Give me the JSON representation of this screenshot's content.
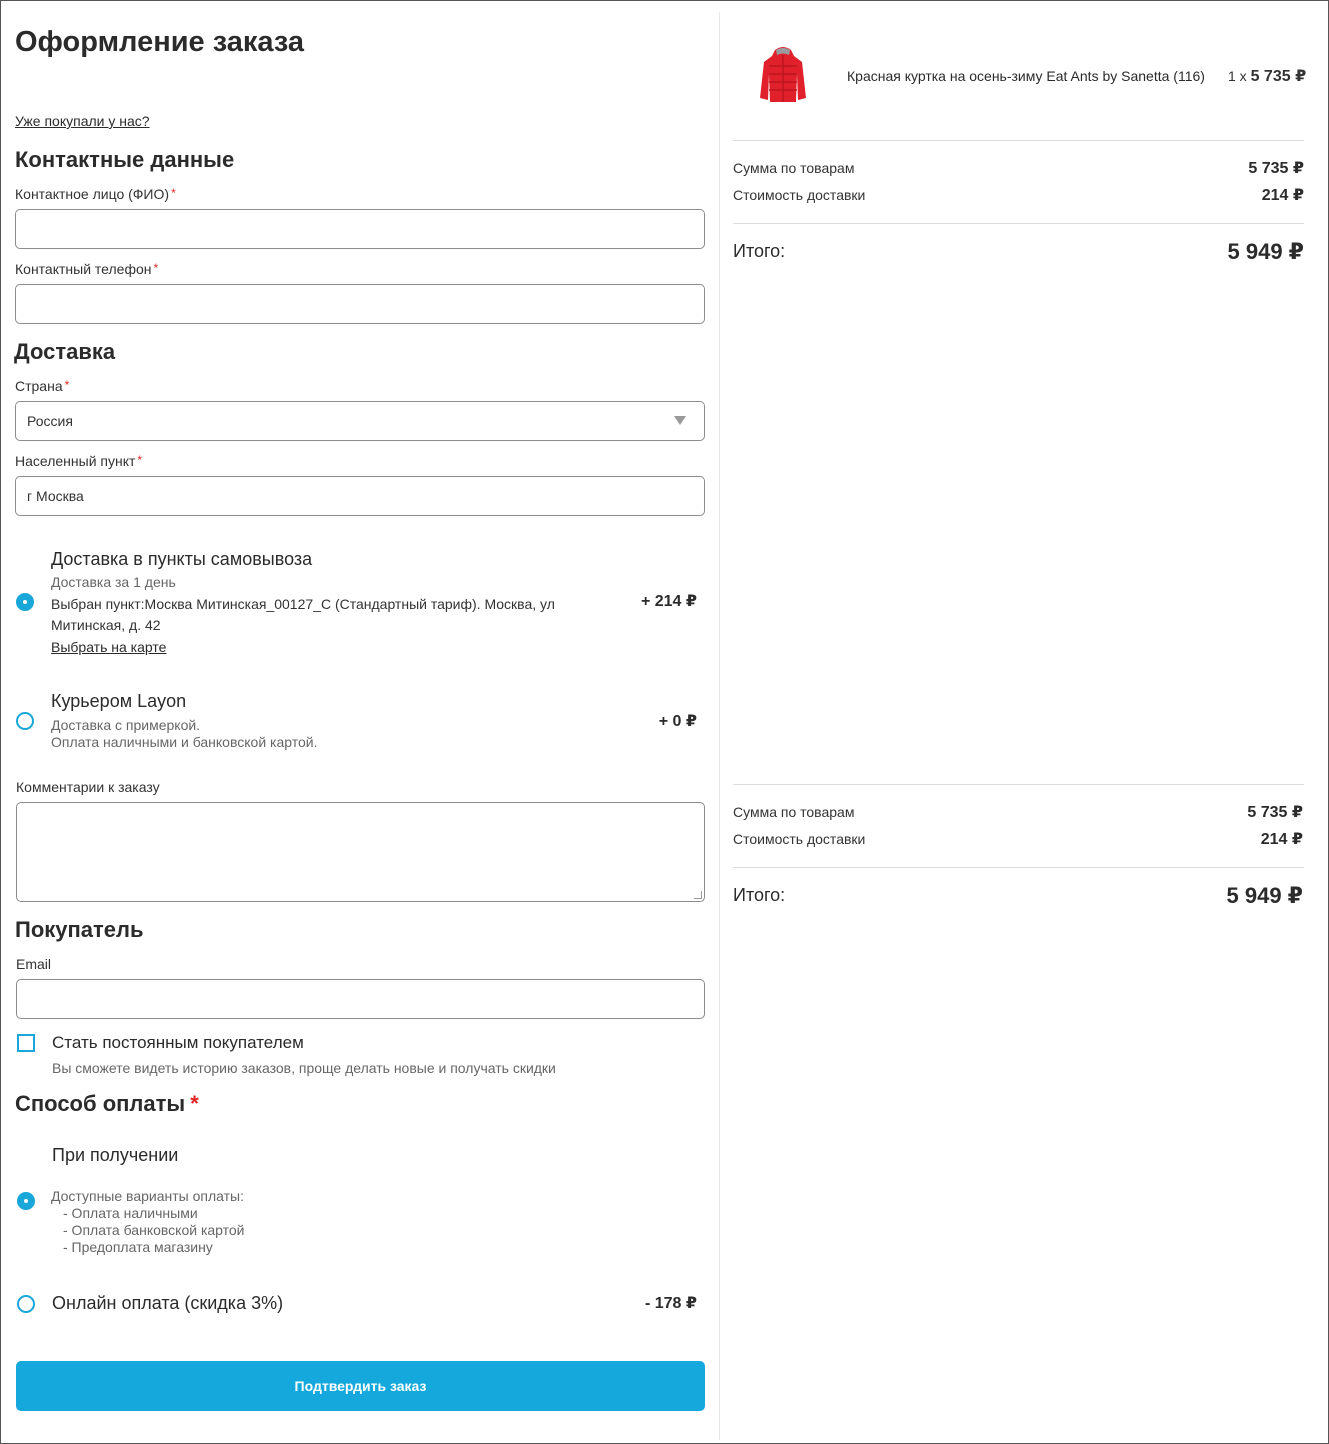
{
  "page": {
    "title": "Оформление заказа",
    "returning_link": "Уже покупали у нас?"
  },
  "contacts": {
    "heading": "Контактные данные",
    "name_label": "Контактное лицо (ФИО)",
    "name_value": "",
    "phone_label": "Контактный телефон",
    "phone_value": ""
  },
  "delivery": {
    "heading": "Доставка",
    "country_label": "Страна",
    "country_value": "Россия",
    "city_label": "Населенный пункт",
    "city_value": "г Москва",
    "options": [
      {
        "title": "Доставка в пункты самовывоза",
        "subtitle": "Доставка за 1 день",
        "desc_line1": "Выбран пункт:Москва Митинская_00127_С (Стандартный тариф). Москва, ул",
        "desc_line2": "Митинская, д. 42",
        "map_link": "Выбрать на карте",
        "price": "+ 214 ₽",
        "selected": true
      },
      {
        "title": "Курьером Layon",
        "subtitle": "Доставка с примеркой.",
        "subtitle2": "Оплата наличными и банковской картой.",
        "price": "+ 0 ₽",
        "selected": false
      }
    ],
    "comment_label": "Комментарии к заказу",
    "comment_value": ""
  },
  "buyer": {
    "heading": "Покупатель",
    "email_label": "Email",
    "email_value": "",
    "regular_label": "Стать постоянным покупателем",
    "regular_hint": "Вы сможете видеть историю заказов, проще делать новые и получать скидки",
    "regular_checked": false
  },
  "payment": {
    "heading": "Способ оплаты",
    "options": [
      {
        "title": "При получении",
        "variants_title": "Доступные варианты оплаты:",
        "variants": [
          "- Оплата наличными",
          "- Оплата банковской картой",
          "- Предоплата магазину"
        ],
        "selected": true
      },
      {
        "title": "Онлайн оплата (скидка 3%)",
        "price": "- 178 ₽",
        "selected": false
      }
    ],
    "submit_label": "Подтвердить заказ"
  },
  "cart": {
    "product": {
      "name": "Красная куртка на осень-зиму Eat Ants by Sanetta (116)",
      "qty": "1 x",
      "price": "5 735 ₽",
      "image_icon": "red-jacket-icon",
      "image_color": "#e0202a"
    },
    "summary_top": {
      "items_label": "Сумма по товарам",
      "items_value": "5 735 ₽",
      "delivery_label": "Стоимость доставки",
      "delivery_value": "214 ₽",
      "total_label": "Итого:",
      "total_value": "5 949 ₽"
    },
    "summary_bottom": {
      "items_label": "Сумма по товарам",
      "items_value": "5 735 ₽",
      "delivery_label": "Стоимость доставки",
      "delivery_value": "214 ₽",
      "total_label": "Итого:",
      "total_value": "5 949 ₽"
    }
  },
  "colors": {
    "accent": "#14a8dc",
    "required": "#e02424",
    "text": "#2b2b2b"
  }
}
